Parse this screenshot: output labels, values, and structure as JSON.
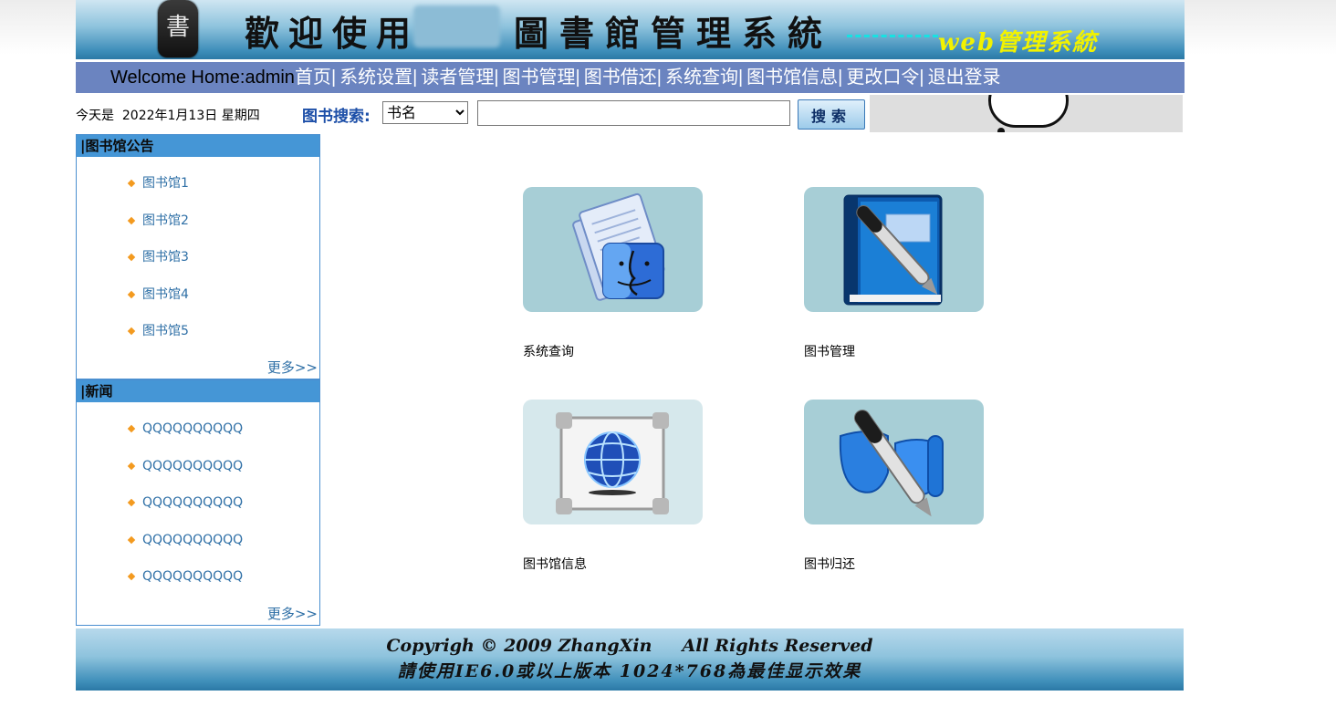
{
  "banner": {
    "seal_char": "書",
    "title_left": "歡迎使用",
    "title_right": "圖書館管理系統",
    "subtitle": "web管理系統"
  },
  "nav": {
    "welcome": "Welcome Home:admin",
    "items": [
      {
        "label": "首页"
      },
      {
        "label": "系统设置"
      },
      {
        "label": "读者管理"
      },
      {
        "label": "图书管理"
      },
      {
        "label": "图书借还"
      },
      {
        "label": "系统查询"
      },
      {
        "label": "图书馆信息"
      },
      {
        "label": "更改口令"
      },
      {
        "label": "退出登录"
      }
    ],
    "separator": "|"
  },
  "toolbar": {
    "date_text": "今天是  2022年1月13日 星期四",
    "search_label": "图书搜索:",
    "search_select_value": "书名",
    "search_input_value": "",
    "search_button_label": "搜索"
  },
  "sidebar": {
    "notice": {
      "title": "|图书馆公告",
      "items": [
        {
          "label": "图书馆1"
        },
        {
          "label": "图书馆2"
        },
        {
          "label": "图书馆3"
        },
        {
          "label": "图书馆4"
        },
        {
          "label": "图书馆5"
        }
      ],
      "more": "更多>>"
    },
    "news": {
      "title": "|新闻",
      "items": [
        {
          "label": "QQQQQQQQQQ"
        },
        {
          "label": "QQQQQQQQQQ"
        },
        {
          "label": "QQQQQQQQQQ"
        },
        {
          "label": "QQQQQQQQQQ"
        },
        {
          "label": "QQQQQQQQQQ"
        }
      ],
      "more": "更多>>"
    }
  },
  "main": {
    "tiles": [
      {
        "label": "系统查询",
        "icon": "finder-documents-icon"
      },
      {
        "label": "图书管理",
        "icon": "book-pen-icon"
      },
      {
        "label": "图书馆信息",
        "icon": "globe-frame-icon"
      },
      {
        "label": "图书归还",
        "icon": "pen-return-icon"
      }
    ]
  },
  "footer": {
    "copyright": "Copyrigh © 2009 ZhangXin     All Rights Reserved",
    "note": "請使用IE6.0或以上版本 1024*768為最佳显示效果"
  },
  "colors": {
    "nav_bg": "#6b84c0",
    "panel_header_bg": "#4596d6",
    "link": "#2e6fa6",
    "bullet": "#f39a1f",
    "tile_bg": "#a7ced6"
  }
}
